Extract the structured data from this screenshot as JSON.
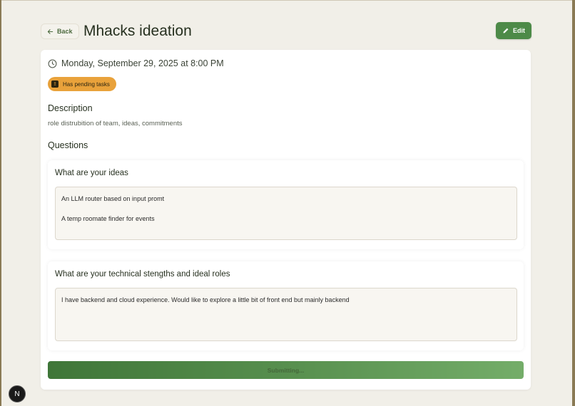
{
  "header": {
    "back_label": "Back",
    "title": "Mhacks ideation",
    "edit_label": "Edit"
  },
  "event": {
    "datetime": "Monday, September 29, 2025 at 8:00 PM",
    "status_badge": "Has pending tasks"
  },
  "description": {
    "heading": "Description",
    "text": "role distrubition of team, ideas, commitments"
  },
  "questions": {
    "heading": "Questions",
    "items": [
      {
        "label": "What are your ideas",
        "answer_lines": [
          "An LLM router based on input promt",
          "A temp roomate finder for events"
        ]
      },
      {
        "label": "What are your technical stengths and ideal roles",
        "answer_lines": [
          "I have backend and cloud experience. Would like to explore a little bit of front end but mainly backend"
        ]
      }
    ]
  },
  "submit": {
    "label": "Submitting..."
  },
  "devtools": {
    "badge_letter": "N"
  },
  "colors": {
    "accent_green": "#4d8a48",
    "badge_orange": "#e9a23b",
    "background": "#f1efe8"
  }
}
